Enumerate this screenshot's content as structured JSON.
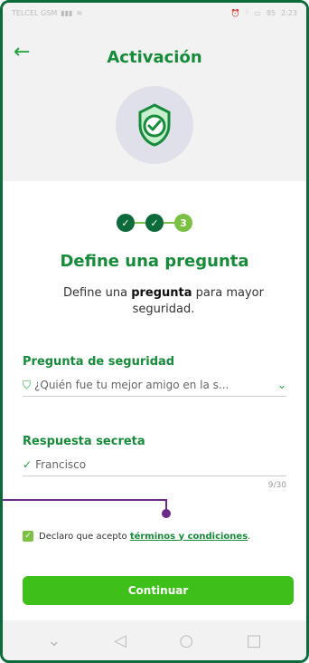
{
  "status_bar": {
    "carrier": "TELCEL GSM",
    "signal_icon": "signal-icon",
    "wifi_icon": "wifi-icon",
    "right_icons": [
      "alarm-icon",
      "vibrate-icon",
      "battery-icon"
    ],
    "battery": "85",
    "time": "2:23"
  },
  "header": {
    "title": "Activación",
    "back_icon": "arrow-left-icon"
  },
  "stepper": {
    "steps": [
      {
        "label": "✓",
        "state": "done"
      },
      {
        "label": "✓",
        "state": "done"
      },
      {
        "label": "3",
        "state": "current"
      }
    ]
  },
  "content": {
    "heading": "Define una pregunta",
    "subtitle_prefix": "Define una ",
    "subtitle_bold": "pregunta",
    "subtitle_suffix": " para mayor seguridad."
  },
  "fields": {
    "question_label": "Pregunta de seguridad",
    "question_value": "¿Quién fue tu mejor amigo en la s...",
    "answer_label": "Respuesta secreta",
    "answer_value": "Francisco",
    "counter": "9/30"
  },
  "terms": {
    "prefix": "Declaro que acepto ",
    "link": "términos y condiciones",
    "suffix": "."
  },
  "actions": {
    "continue": "Continuar"
  },
  "navbar": {
    "items": [
      "chevron-down-icon",
      "back-triangle-icon",
      "home-circle-icon",
      "recents-square-icon"
    ]
  }
}
